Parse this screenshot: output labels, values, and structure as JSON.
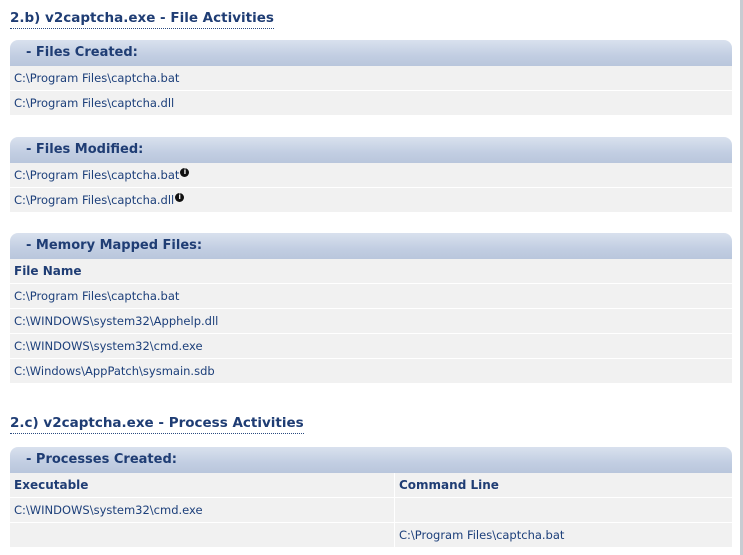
{
  "file_section": {
    "heading": "2.b) v2captcha.exe - File Activities",
    "files_created": {
      "title": "- Files Created:",
      "rows": [
        "C:\\Program Files\\captcha.bat",
        "C:\\Program Files\\captcha.dll"
      ]
    },
    "files_modified": {
      "title": "- Files Modified:",
      "rows": [
        "C:\\Program Files\\captcha.bat",
        "C:\\Program Files\\captcha.dll"
      ],
      "info_icon": "info-icon"
    },
    "memory_mapped": {
      "title": "- Memory Mapped Files:",
      "column_header": "File Name",
      "rows": [
        "C:\\Program Files\\captcha.bat",
        "C:\\WINDOWS\\system32\\Apphelp.dll",
        "C:\\WINDOWS\\system32\\cmd.exe",
        "C:\\Windows\\AppPatch\\sysmain.sdb"
      ]
    }
  },
  "process_section": {
    "heading": "2.c) v2captcha.exe - Process Activities",
    "processes_created": {
      "title": "- Processes Created:",
      "columns": [
        "Executable",
        "Command Line"
      ],
      "rows": [
        [
          "C:\\WINDOWS\\system32\\cmd.exe",
          ""
        ],
        [
          "",
          "C:\\Program Files\\captcha.bat"
        ]
      ]
    }
  }
}
